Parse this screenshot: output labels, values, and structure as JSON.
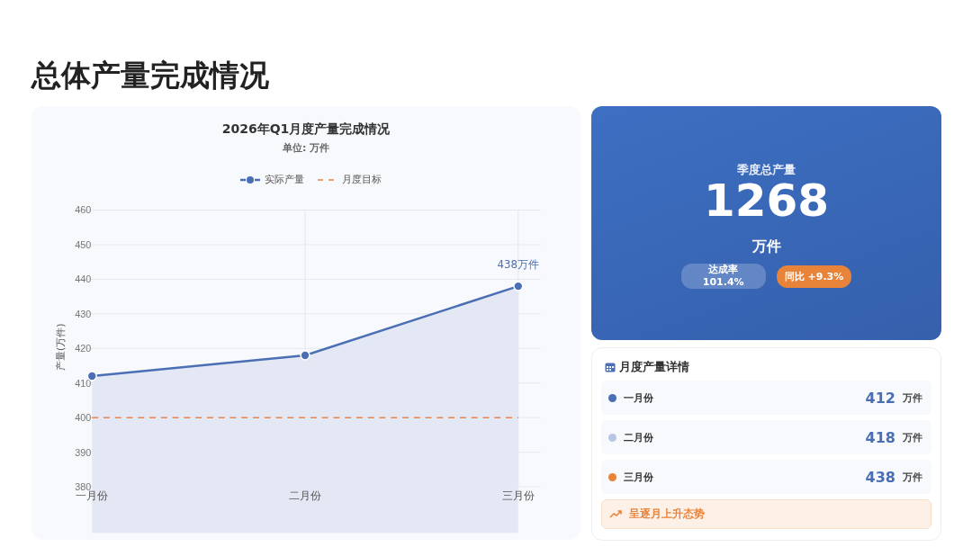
{
  "page_title": "总体产量完成情况",
  "chart_card": {
    "subtitle": "单位: 万件",
    "chart_data": {
      "type": "line",
      "title": "2026年Q1月度产量完成情况",
      "ylabel": "产量(万件)",
      "categories": [
        "一月份",
        "二月份",
        "三月份"
      ],
      "series": [
        {
          "name": "实际产量",
          "type": "area",
          "color": "#4a6fb5",
          "values": [
            412,
            418,
            438
          ]
        },
        {
          "name": "月度目标",
          "type": "line",
          "line_style": "dashed",
          "color": "#e8834a",
          "values": [
            400,
            400,
            400
          ]
        }
      ],
      "ylim": [
        380,
        460
      ],
      "grid": true,
      "yticks": [
        380,
        390,
        400,
        410,
        420,
        430,
        440,
        450,
        460
      ],
      "annotations": [
        {
          "text": "438万件",
          "x": "三月份",
          "y": 438
        }
      ]
    }
  },
  "summary": {
    "label": "季度总产量",
    "value": "1268",
    "unit": "万件",
    "rate": "达成率 101.4%",
    "yoy": "同比 +9.3%"
  },
  "details": {
    "title": "月度产量详情",
    "months": [
      {
        "name": "一月份",
        "value": "412",
        "unit": "万件",
        "color": "#4a6fb5"
      },
      {
        "name": "二月份",
        "value": "418",
        "unit": "万件",
        "color": "#b8c6e6"
      },
      {
        "name": "三月份",
        "value": "438",
        "unit": "万件",
        "color": "#e8833a"
      }
    ],
    "trend": "呈逐月上升态势"
  }
}
